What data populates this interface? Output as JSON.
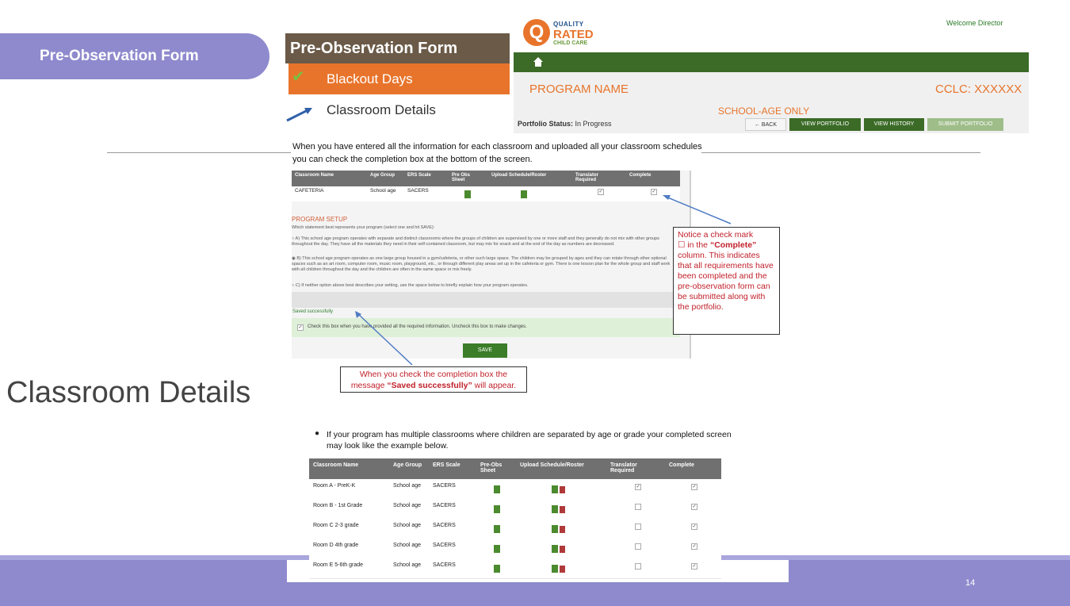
{
  "slide": {
    "title": "Pre-Observation Form",
    "side_title": "Classroom Details",
    "page_number": "14"
  },
  "menu": {
    "header": "Pre-Observation Form",
    "items": [
      {
        "label": "Blackout Days",
        "state": "completed"
      },
      {
        "label": "Classroom Details",
        "state": "current"
      }
    ]
  },
  "portal_header": {
    "logo": {
      "line1": "QUALITY",
      "line2": "RATED",
      "line3": "CHILD CARE",
      "mark": "Q"
    },
    "welcome": "Welcome Director",
    "home_icon": "home-icon",
    "program_name": "PROGRAM NAME",
    "cclc": "CCLC: XXXXXX",
    "school_age": "SCHOOL-AGE ONLY",
    "portfolio_status_label": "Portfolio Status:",
    "portfolio_status_value": "In Progress",
    "buttons": {
      "back": "← BACK",
      "view_portfolio": "VIEW PORTFOLIO",
      "view_history": "VIEW HISTORY",
      "submit_portfolio": "SUBMIT PORTFOLIO"
    }
  },
  "intro_text": "When you have entered all the information for each classroom and uploaded all your classroom schedules you can check the completion box at the bottom of the screen.",
  "form": {
    "columns": [
      "Classroom Name",
      "Age Group",
      "ERS Scale",
      "Pre Obs Sheet",
      "Upload Schedule/Roster",
      "Translator Required",
      "Complete"
    ],
    "row": {
      "classroom": "CAFETERIA",
      "age_group": "School age",
      "ers_scale": "SACERS",
      "translator": true,
      "complete": true
    },
    "program_setup_title": "PROGRAM SETUP",
    "program_setup_prompt": "Which statement best represents your program (select one and hit SAVE):",
    "options": [
      {
        "text": "A) This school age program operates with separate and distinct classrooms where the groups of children are supervised by one or more staff and they generally do not mix with other groups throughout the day. They have all the materials they need in their self-contained classroom, but may mix for snack and at the end of the day as numbers are decreased.",
        "selected": false
      },
      {
        "text": "B) This school age program operates as one large group housed in a gym/cafeteria, or other such large space. The children may be grouped by ages and they can rotate through other optional spaces such as an art room, computer room, music room, playground, etc., or through different play areas set up in the cafeteria or gym. There is one lesson plan for the whole group and staff work with all children throughout the day and the children are often in the same space or mix freely.",
        "selected": true
      },
      {
        "text": "C) If neither option above best describes your setting, use the space below to briefly explain how your program operates.",
        "selected": false
      }
    ],
    "saved_message": "Saved successfully",
    "completion_text": "Check this box when you have provided all the required information. Uncheck this box to make changes.",
    "completion_checked": true,
    "save_label": "SAVE"
  },
  "callouts": {
    "right": {
      "part1": "Notice a check mark",
      "part2": "☐ in the ",
      "part3": "“Complete”",
      "part4": " column. This indicates that all requirements have been completed and the pre-observation form can be submitted along with the portfolio."
    },
    "bottom": {
      "line1": "When you check the completion box the",
      "line2_pre": "message ",
      "line2_bold": "“Saved successfully”",
      "line2_post": " will appear."
    }
  },
  "bullet_text": "If your program has multiple classrooms where children are separated by age or grade your completed screen may look like the example below.",
  "table2": {
    "columns": [
      "Classroom Name",
      "Age Group",
      "ERS Scale",
      "Pre-Obs Sheet",
      "Upload Schedule/Roster",
      "Translator Required",
      "Complete"
    ],
    "rows": [
      {
        "classroom": "Room A - PreK-K",
        "age_group": "School age",
        "ers_scale": "SACERS",
        "translator": true,
        "complete": true
      },
      {
        "classroom": "Room B - 1st Grade",
        "age_group": "School age",
        "ers_scale": "SACERS",
        "translator": false,
        "complete": true
      },
      {
        "classroom": "Room C 2-3 grade",
        "age_group": "School age",
        "ers_scale": "SACERS",
        "translator": false,
        "complete": true
      },
      {
        "classroom": "Room D 4th grade",
        "age_group": "School age",
        "ers_scale": "SACERS",
        "translator": false,
        "complete": true
      },
      {
        "classroom": "Room E 5-6th grade",
        "age_group": "School age",
        "ers_scale": "SACERS",
        "translator": false,
        "complete": true
      }
    ]
  },
  "colors": {
    "slide_purple": "#8e8acd",
    "portal_green": "#3b6b27",
    "accent_orange": "#e8742b",
    "callout_red": "#c0202a"
  }
}
